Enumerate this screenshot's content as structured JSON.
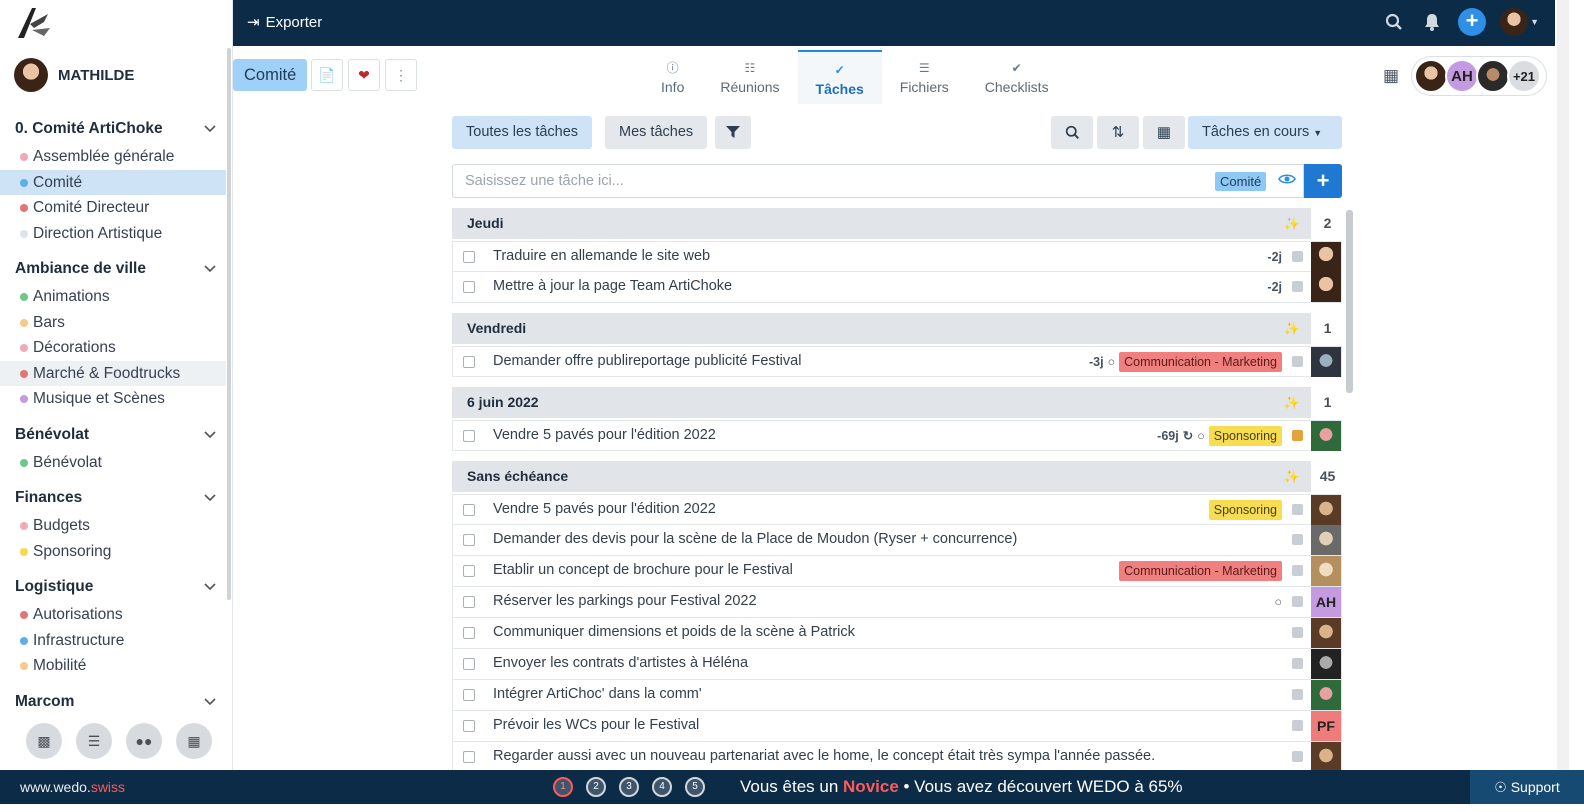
{
  "sidebar": {
    "user_name": "MATHILDE",
    "sections": [
      {
        "title": "0. Comité ArtiChoke",
        "items": [
          {
            "label": "Assemblée générale",
            "color": "#f4a7b9"
          },
          {
            "label": "Comité",
            "color": "#5aaeea",
            "active": true
          },
          {
            "label": "Comité Directeur",
            "color": "#e07575"
          },
          {
            "label": "Direction Artistique",
            "color": "#dde3e8"
          }
        ]
      },
      {
        "title": "Ambiance de ville",
        "items": [
          {
            "label": "Animations",
            "color": "#6cc88a"
          },
          {
            "label": "Bars",
            "color": "#f8c98a"
          },
          {
            "label": "Décorations",
            "color": "#f4a7b9"
          },
          {
            "label": "Marché & Foodtrucks",
            "color": "#e07575",
            "hover": true
          },
          {
            "label": "Musique et Scènes",
            "color": "#c49ae0"
          }
        ]
      },
      {
        "title": "Bénévolat",
        "items": [
          {
            "label": "Bénévolat",
            "color": "#6cc88a"
          }
        ]
      },
      {
        "title": "Finances",
        "items": [
          {
            "label": "Budgets",
            "color": "#f4a7b9"
          },
          {
            "label": "Sponsoring",
            "color": "#f7d84a"
          }
        ]
      },
      {
        "title": "Logistique",
        "items": [
          {
            "label": "Autorisations",
            "color": "#e07575"
          },
          {
            "label": "Infrastructure",
            "color": "#5aaeea"
          },
          {
            "label": "Mobilité",
            "color": "#f8c98a"
          }
        ]
      },
      {
        "title": "Marcom",
        "items": []
      }
    ]
  },
  "topbar": {
    "export_label": "Exporter"
  },
  "header": {
    "workspace_label": "Comité",
    "tabs": [
      {
        "label": "Info",
        "icon": "info-icon"
      },
      {
        "label": "Réunions",
        "icon": "calendar-icon"
      },
      {
        "label": "Tâches",
        "icon": "check-icon",
        "active": true
      },
      {
        "label": "Fichiers",
        "icon": "file-icon"
      },
      {
        "label": "Checklists",
        "icon": "checklist-icon"
      }
    ],
    "members_initials": "AH",
    "members_more": "+21"
  },
  "toolbar": {
    "all_tasks": "Toutes les tâches",
    "my_tasks": "Mes tâches",
    "status_filter": "Tâches en cours"
  },
  "task_input": {
    "placeholder": "Saisissez une tâche ici...",
    "tag": "Comité"
  },
  "groups": [
    {
      "title": "Jeudi",
      "count": "2",
      "tasks": [
        {
          "text": "Traduire en allemande le site web",
          "due": "-2j",
          "avatar": "pa"
        },
        {
          "text": "Mettre à jour la page Team ArtiChoke",
          "due": "-2j",
          "avatar": "pa"
        }
      ]
    },
    {
      "title": "Vendredi",
      "count": "1",
      "tasks": [
        {
          "text": "Demander offre publireportage publicité Festival",
          "due": "-3j",
          "comment": true,
          "tag": "Communication - Marketing",
          "tagtype": "com",
          "avatar": "pb"
        }
      ]
    },
    {
      "title": "6 juin 2022",
      "count": "1",
      "tasks": [
        {
          "text": "Vendre 5 pavés pour l'édition 2022",
          "due": "-69j",
          "repeat": true,
          "comment": true,
          "tag": "Sponsoring",
          "tagtype": "spo",
          "sq": "or",
          "avatar": "pd"
        }
      ]
    },
    {
      "title": "Sans échéance",
      "count": "45",
      "tasks": [
        {
          "text": "Vendre 5 pavés pour l'édition 2022",
          "tag": "Sponsoring",
          "tagtype": "spo",
          "avatar": "pc"
        },
        {
          "text": "Demander des devis pour la scène de la Place de Moudon (Ryser + concurrence)",
          "avatar": "pe"
        },
        {
          "text": "Etablir un concept de brochure pour le Festival",
          "tag": "Communication - Marketing",
          "tagtype": "com",
          "avatar": "pf"
        },
        {
          "text": "Réserver les parkings pour Festival 2022",
          "comment": true,
          "avatar": "ah",
          "initials": "AH"
        },
        {
          "text": "Communiquer dimensions et poids de la scène à Patrick",
          "avatar": "pc"
        },
        {
          "text": "Envoyer les contrats d'artistes à Héléna",
          "avatar": "pg"
        },
        {
          "text": "Intégrer ArtiChoc' dans la comm'",
          "avatar": "pd"
        },
        {
          "text": "Prévoir les WCs pour le Festival",
          "avatar": "pfi",
          "initials": "PF"
        },
        {
          "text": "Regarder aussi avec un nouveau partenariat avec le home, le concept était très sympa l'année passée.",
          "avatar": "pc"
        }
      ]
    }
  ],
  "footer": {
    "site_main": "www.wedo.",
    "site_suffix": "swiss",
    "steps": [
      "1",
      "2",
      "3",
      "4",
      "5"
    ],
    "msg_before": "Vous êtes un ",
    "msg_level": "Novice",
    "msg_after": " • Vous avez découvert WEDO à 65%",
    "support": "Support"
  }
}
